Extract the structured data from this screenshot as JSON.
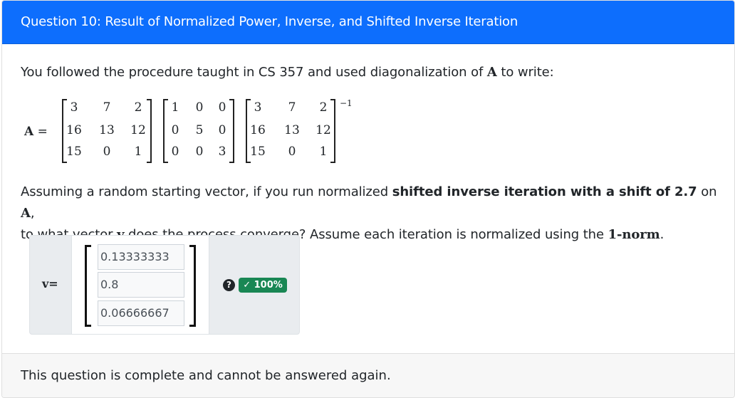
{
  "header": {
    "title": "Question 10: Result of Normalized Power, Inverse, and Shifted Inverse Iteration"
  },
  "intro": {
    "text_before": "You followed the procedure taught in CS 357 and used diagonalization of ",
    "matrix_name": "A",
    "text_after": " to write:"
  },
  "equation": {
    "lhs": "A =",
    "matrix1": [
      [
        "3",
        "7",
        "2"
      ],
      [
        "16",
        "13",
        "12"
      ],
      [
        "15",
        "0",
        "1"
      ]
    ],
    "matrix2": [
      [
        "1",
        "0",
        "0"
      ],
      [
        "0",
        "5",
        "0"
      ],
      [
        "0",
        "0",
        "3"
      ]
    ],
    "matrix3": [
      [
        "3",
        "7",
        "2"
      ],
      [
        "16",
        "13",
        "12"
      ],
      [
        "15",
        "0",
        "1"
      ]
    ],
    "exponent": "−1"
  },
  "question": {
    "part1": "Assuming a random starting vector, if you run normalized ",
    "bold1": "shifted inverse iteration with a shift of 2.7",
    "part2": " on ",
    "matrix_name": "A",
    "part3": ",",
    "part4": "to what vector ",
    "vector_name": "v",
    "part5": " does the process converge? Assume each iteration is normalized using the ",
    "norm": "1-norm",
    "part6": "."
  },
  "answer": {
    "label": "v=",
    "values": [
      "0.13333333",
      "0.8",
      "0.06666667"
    ],
    "help_icon": "?",
    "score_badge": "✓ 100%",
    "badge_color": "#198754"
  },
  "footer": {
    "message": "This question is complete and cannot be answered again."
  }
}
